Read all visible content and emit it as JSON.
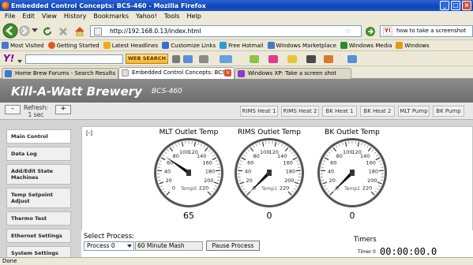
{
  "window": {
    "title": "Embedded Control Concepts: BCS-460 - Mozilla Firefox"
  },
  "menu": [
    "File",
    "Edit",
    "View",
    "History",
    "Bookmarks",
    "Yahoo!",
    "Tools",
    "Help"
  ],
  "nav": {
    "url": "http://192.168.0.13/index.html",
    "search_value": "how to take a screenshot"
  },
  "bookmarks": [
    {
      "label": "Most Visited",
      "color": "#4a78c8"
    },
    {
      "label": "Getting Started",
      "color": "#e0561b"
    },
    {
      "label": "Latest Headlines",
      "color": "#f2a91b"
    },
    {
      "label": "Customize Links",
      "color": "#3a6fc8"
    },
    {
      "label": "Free Hotmail",
      "color": "#2c9ad6"
    },
    {
      "label": "Windows Marketplace",
      "color": "#4a78c8"
    },
    {
      "label": "Windows Media",
      "color": "#2d8b2d"
    },
    {
      "label": "Windows",
      "color": "#e39a1a"
    }
  ],
  "yahoo": {
    "logo": "Y!",
    "search_button": "WEB SEARCH"
  },
  "tabs": [
    {
      "label": "Home Brew Forums - Search Results",
      "active": false
    },
    {
      "label": "Embedded Control Concepts: BCS...",
      "active": true
    },
    {
      "label": "Windows XP: Take a screen shot",
      "active": false
    }
  ],
  "app": {
    "title": "Kill-A-Watt Brewery",
    "model": "BCS-460",
    "refresh_label": "Refresh:",
    "refresh_value": "1 sec",
    "minus": "-",
    "plus": "+",
    "top_buttons": [
      "RIMS Heat 1",
      "RIMS Heat 2",
      "BK Heat 1",
      "BK Heat 2",
      "MLT Pump",
      "BK Pump"
    ],
    "sidebar": [
      "Main Control",
      "Data Log",
      "Add/Edit State Machines",
      "Temp Setpoint Adjust",
      "Thermo Test",
      "Ethernet Settings",
      "System Settings"
    ],
    "collapse": "[-]",
    "gauges": [
      {
        "title": "MLT Outlet Temp",
        "sensor": "Temp0",
        "value": "65",
        "reading": 65
      },
      {
        "title": "RIMS Outlet Temp",
        "sensor": "Temp1",
        "value": "0",
        "reading": 0
      },
      {
        "title": "BK Outlet Temp",
        "sensor": "Temp2",
        "value": "0",
        "reading": 0
      }
    ],
    "gauge_scale": {
      "min": 0,
      "max": 220,
      "ticks": [
        "0",
        "20",
        "40",
        "60",
        "80",
        "100",
        "120",
        "140",
        "160",
        "180",
        "200",
        "220"
      ]
    },
    "select_process_label": "Select Process:",
    "process_selected": "Process 0",
    "process_state": "60 Minute Mash",
    "pause_button": "Pause Process",
    "timers_label": "Timers",
    "timer_name": "Timer 0",
    "timer_value": "00:00:00.0"
  },
  "status": {
    "text": "Done"
  }
}
